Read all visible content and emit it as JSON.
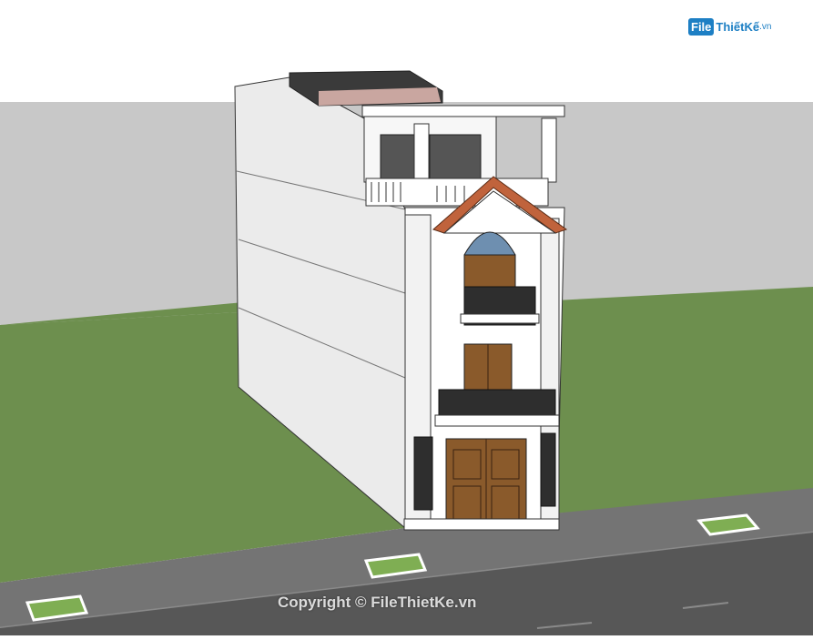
{
  "watermark": {
    "logo_box": "File",
    "logo_name": "ThiếtKế",
    "logo_suffix": ".vn",
    "copyright": "Copyright © FileThietKe.vn"
  },
  "colors": {
    "sky": "#ffffff",
    "backdrop": "#c8c8c8",
    "grass": "#6d8f4e",
    "sidewalk": "#6f6f6f",
    "road": "#575757",
    "wall_side": "#ececec",
    "facade": "#ffffff",
    "roof_tile": "#c0633c",
    "door_wood": "#8a5a2b",
    "window_glass": "#6e8fb0"
  },
  "icons": [
    "file-logo-icon",
    "copyright-icon"
  ]
}
